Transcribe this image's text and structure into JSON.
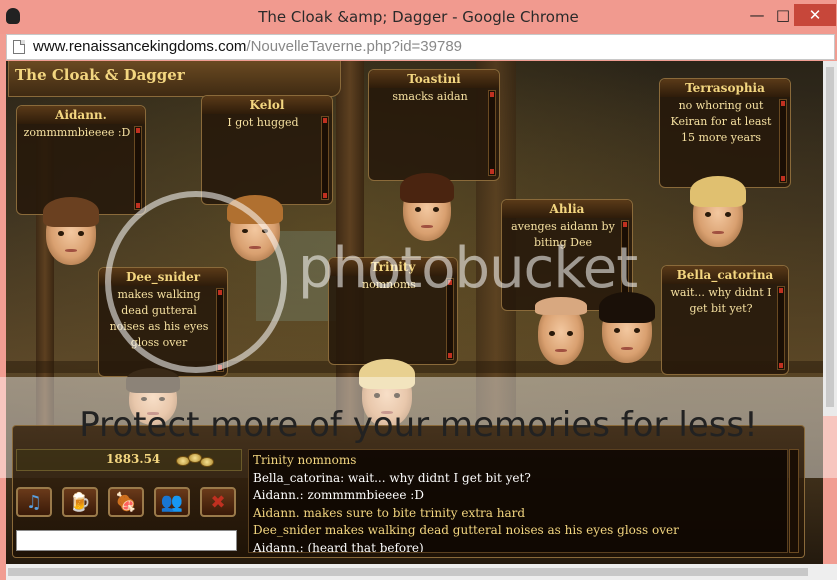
{
  "window": {
    "title": "The Cloak &amp; Dagger - Google Chrome",
    "min_glyph": "—",
    "max_glyph": "□",
    "close_glyph": "✕"
  },
  "browser": {
    "url_host": "www.renaissancekingdoms.com",
    "url_path": "/NouvelleTaverne.php?id=39789"
  },
  "tavern": {
    "title": "The Cloak & Dagger"
  },
  "bubbles": [
    {
      "name": "Aidann.",
      "message": "zommmmbieeee :D"
    },
    {
      "name": "Kelol",
      "message": "I got hugged"
    },
    {
      "name": "Toastini",
      "message": "smacks aidan"
    },
    {
      "name": "Terrasophia",
      "message": "no whoring out Keiran for at least 15 more years"
    },
    {
      "name": "Ahlia",
      "message": "avenges aidann by biting Dee"
    },
    {
      "name": "Dee_snider",
      "message": "makes walking dead gutteral noises as his eyes gloss over"
    },
    {
      "name": "Trinity",
      "message": "nomnoms"
    },
    {
      "name": "Bella_catorina",
      "message": "wait... why didnt I get bit yet?"
    }
  ],
  "watermark": {
    "brand": "photobucket",
    "tagline": "Protect more of your memories for less!"
  },
  "panel": {
    "gold": "1883.54",
    "chat_input_value": "",
    "buttons": [
      {
        "icon": "music-note-icon",
        "glyph": "♫",
        "color": "#5aa0e0"
      },
      {
        "icon": "tankard-icon",
        "glyph": "🍺",
        "color": "#e04020"
      },
      {
        "icon": "meat-leg-icon",
        "glyph": "🍖",
        "color": "#e0d0c0"
      },
      {
        "icon": "people-icon",
        "glyph": "👥",
        "color": "#60c0f0"
      },
      {
        "icon": "close-x-icon",
        "glyph": "✖",
        "color": "#c03020"
      }
    ]
  },
  "chat_log": [
    {
      "text": "Trinity nomnoms",
      "kind": "emote"
    },
    {
      "text": "Bella_catorina: wait... why didnt I get bit yet?",
      "kind": "say"
    },
    {
      "text": "Aidann.: zommmmbieeee :D",
      "kind": "say"
    },
    {
      "text": "Aidann. makes sure to bite trinity extra hard",
      "kind": "emote"
    },
    {
      "text": "Dee_snider makes walking dead gutteral noises as his eyes gloss over",
      "kind": "emote"
    },
    {
      "text": "Aidann.: (heard that before)",
      "kind": "say"
    }
  ]
}
